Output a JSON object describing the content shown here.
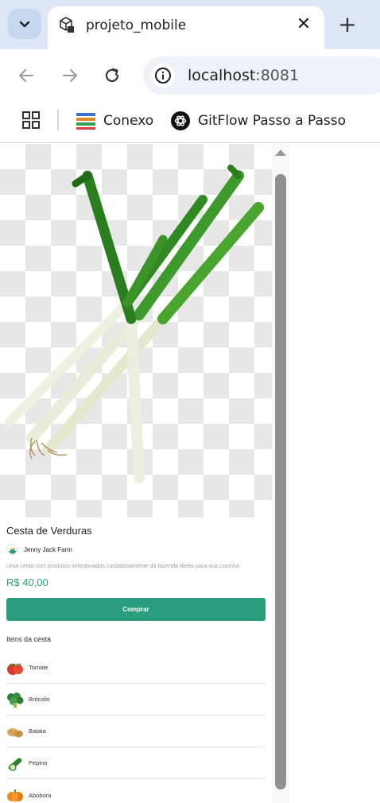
{
  "browser": {
    "tab_title": "projeto_mobile",
    "tab_close": "✕",
    "new_tab": "+",
    "url_host": "localhost",
    "url_port": ":8081",
    "bookmarks": [
      {
        "label": "Conexo",
        "icon": "stacked-bars-icon"
      },
      {
        "label": "GitFlow Passo a Passo",
        "icon": "openai-icon"
      }
    ]
  },
  "product": {
    "title": "Cesta de Verduras",
    "farm": "Jenny Jack Farm",
    "description": "Uma cesta com produtos selecionados cuidadosamente da fazenda direto para sua cozinha",
    "price": "R$ 40,00",
    "buy_label": "Comprar",
    "accent_color": "#2a9d7d"
  },
  "items_section": {
    "title": "Itens da cesta",
    "items": [
      {
        "label": "Tomate",
        "icon": "tomato-icon"
      },
      {
        "label": "Brócolis",
        "icon": "broccoli-icon"
      },
      {
        "label": "Batata",
        "icon": "potato-icon"
      },
      {
        "label": "Pepino",
        "icon": "cucumber-icon"
      },
      {
        "label": "Abóbora",
        "icon": "pumpkin-icon"
      }
    ]
  }
}
